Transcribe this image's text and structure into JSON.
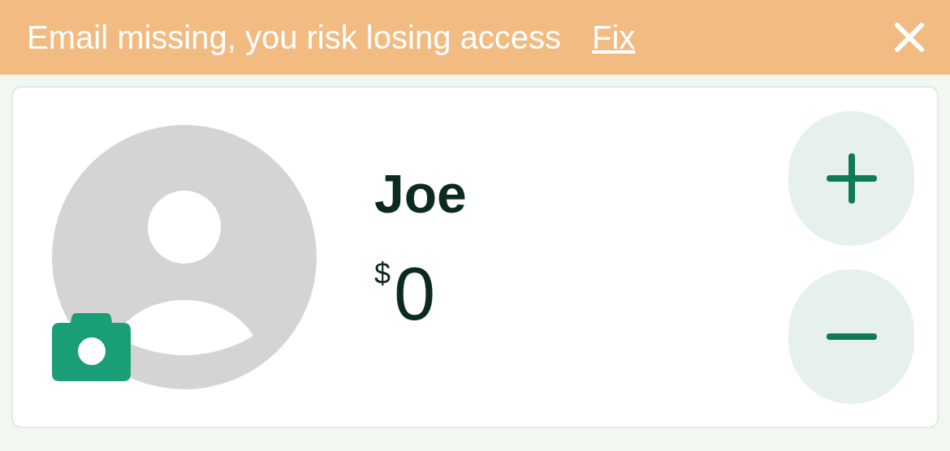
{
  "banner": {
    "message": "Email missing, you risk losing access",
    "link": "Fix"
  },
  "profile": {
    "name": "Joe",
    "currency": "$",
    "amount": "0"
  }
}
